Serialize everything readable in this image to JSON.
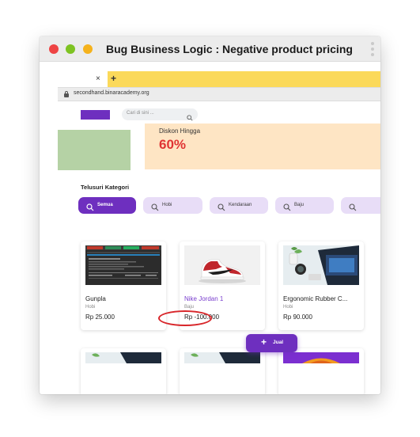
{
  "window": {
    "title": "Bug  Business Logic : Negative product pricing"
  },
  "browser": {
    "tab_close": "×",
    "tab_new": "+",
    "url": "secondhand.binaracademy.org"
  },
  "header": {
    "search_placeholder": "Cari di sini ..."
  },
  "banner": {
    "subtitle": "Diskon Hingga",
    "headline": "60%"
  },
  "categories": {
    "title": "Telusuri Kategori",
    "items": [
      {
        "label": "Semua",
        "active": true
      },
      {
        "label": "Hobi",
        "active": false
      },
      {
        "label": "Kendaraan",
        "active": false
      },
      {
        "label": "Baju",
        "active": false
      },
      {
        "label": "",
        "active": false
      }
    ]
  },
  "products": [
    {
      "name": "Gunpla",
      "category": "Hobi",
      "price": "Rp 25.000"
    },
    {
      "name": "Nike Jordan 1",
      "category": "Baju",
      "price": "Rp -100.000"
    },
    {
      "name": "Ergonomic Rubber C...",
      "category": "Hobi",
      "price": "Rp 90.000"
    }
  ],
  "fab": {
    "icon": "+",
    "label": "Jual"
  },
  "colors": {
    "brand_purple": "#6e2fbf",
    "banner_peach": "#fee5c4",
    "banner_green": "#b5d2a5",
    "discount_red": "#e03333",
    "annotation_red": "#d8262a",
    "tab_yellow": "#fbd95a"
  }
}
